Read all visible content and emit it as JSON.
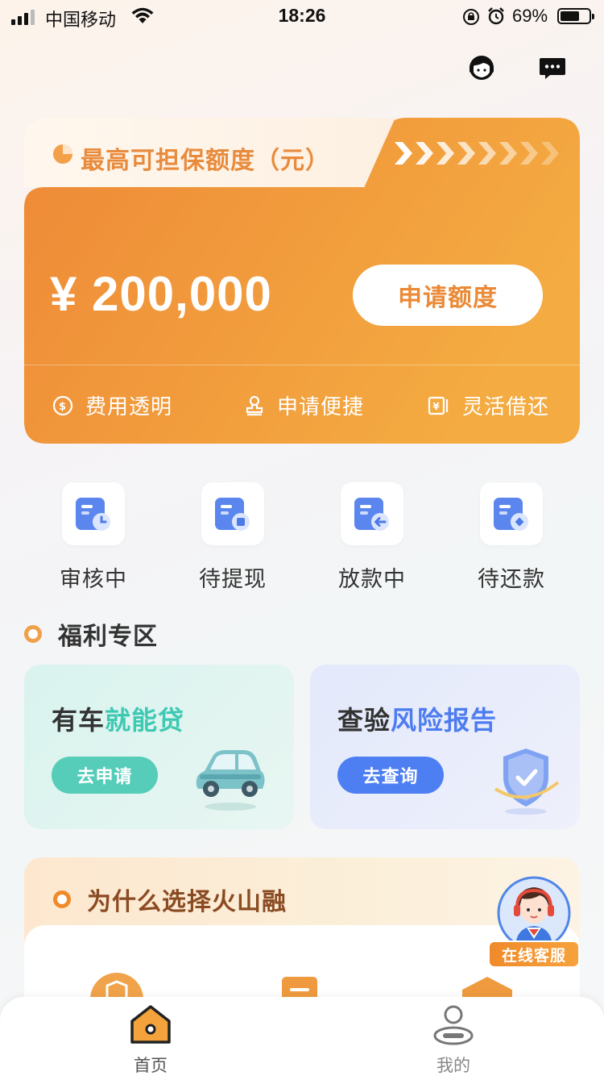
{
  "status_bar": {
    "carrier": "中国移动",
    "time": "18:26",
    "battery": "69%",
    "battery_level": 0.69
  },
  "header": {
    "icons": [
      "customer-service-icon",
      "message-icon"
    ]
  },
  "credit_card": {
    "label": "最高可担保额度（元）",
    "amount": "¥ 200,000",
    "apply_button": "申请额度",
    "features": [
      "费用透明",
      "申请便捷",
      "灵活借还"
    ],
    "colors": {
      "accent": "#ec8a36",
      "gradient_start": "#ed8a38",
      "gradient_end": "#f4a93f"
    }
  },
  "loan_status": {
    "items": [
      {
        "label": "审核中",
        "icon": "reviewing-icon"
      },
      {
        "label": "待提现",
        "icon": "pending-withdraw-icon"
      },
      {
        "label": "放款中",
        "icon": "disbursing-icon"
      },
      {
        "label": "待还款",
        "icon": "pending-repay-icon"
      }
    ]
  },
  "welfare": {
    "title": "福利专区",
    "cards": [
      {
        "title_plain": "有车",
        "title_highlight": "就能贷",
        "button": "去申请",
        "icon": "car-icon"
      },
      {
        "title_plain": "查验",
        "title_highlight": "风险报告",
        "button": "去查询",
        "icon": "shield-icon"
      }
    ]
  },
  "why": {
    "title": "为什么选择火山融"
  },
  "customer_service": {
    "label": "在线客服"
  },
  "tab_bar": {
    "tabs": [
      {
        "label": "首页",
        "active": true
      },
      {
        "label": "我的",
        "active": false
      }
    ]
  }
}
